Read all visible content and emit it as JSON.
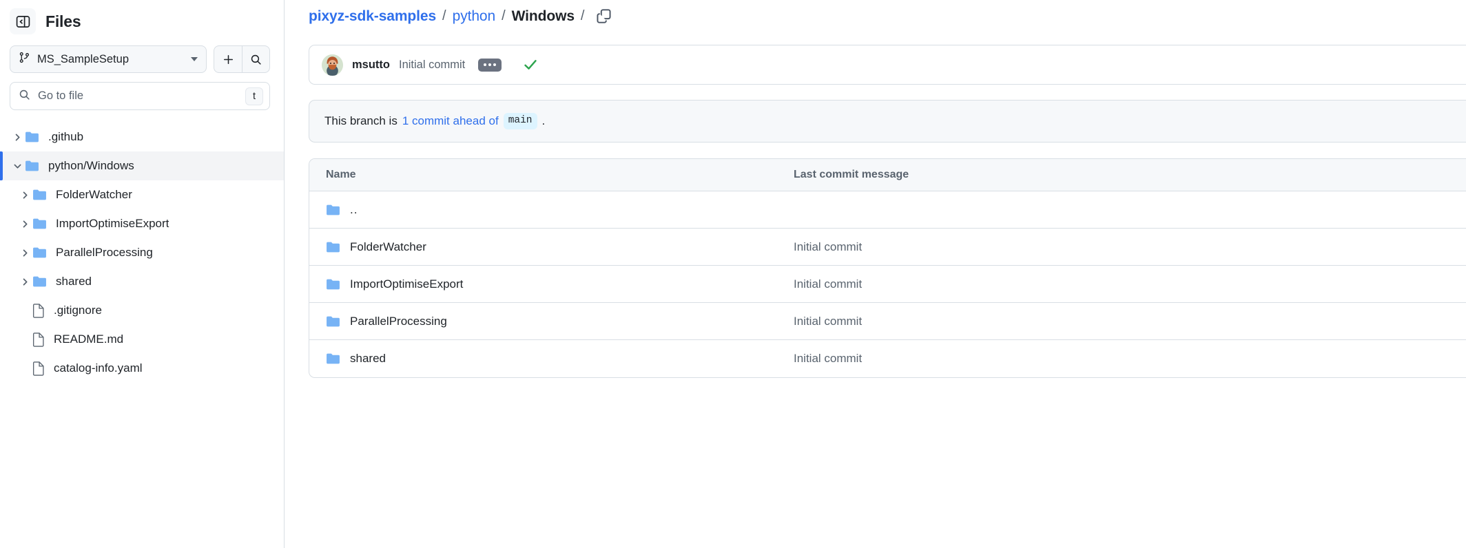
{
  "sidebar": {
    "title": "Files",
    "panel_toggle_icon": "collapse-panel-icon",
    "branch": {
      "name": "MS_SampleSetup",
      "icon": "git-branch-icon",
      "chevron_icon": "chevron-down-icon"
    },
    "add_button_icon": "plus-icon",
    "search_button_icon": "search-icon",
    "file_search": {
      "placeholder": "Go to file",
      "value": "",
      "icon": "search-icon",
      "shortcut": "t"
    },
    "tree": [
      {
        "label": ".github",
        "type": "folder",
        "depth": 0,
        "expanded": false,
        "selected": false
      },
      {
        "label": "python/Windows",
        "type": "folder-open",
        "depth": 0,
        "expanded": true,
        "selected": true
      },
      {
        "label": "FolderWatcher",
        "type": "folder",
        "depth": 1,
        "expanded": false,
        "selected": false
      },
      {
        "label": "ImportOptimiseExport",
        "type": "folder",
        "depth": 1,
        "expanded": false,
        "selected": false
      },
      {
        "label": "ParallelProcessing",
        "type": "folder",
        "depth": 1,
        "expanded": false,
        "selected": false
      },
      {
        "label": "shared",
        "type": "folder",
        "depth": 1,
        "expanded": false,
        "selected": false
      },
      {
        "label": ".gitignore",
        "type": "file",
        "depth": 1,
        "expanded": null,
        "selected": false
      },
      {
        "label": "README.md",
        "type": "file",
        "depth": 1,
        "expanded": null,
        "selected": false
      },
      {
        "label": "catalog-info.yaml",
        "type": "file",
        "depth": 1,
        "expanded": null,
        "selected": false
      }
    ]
  },
  "breadcrumb": {
    "repo": "pixyz-sdk-samples",
    "sep": "/",
    "path_part": "python",
    "current": "Windows",
    "trailing_sep": "/",
    "copy_icon": "copy-path-icon"
  },
  "commit": {
    "author": "msutto",
    "message": "Initial commit",
    "more_icon": "ellipsis-icon",
    "status_icon": "check-success-icon",
    "status_color": "#2da44e",
    "avatar_name": "avatar"
  },
  "notice": {
    "prefix": "This branch is",
    "link": "1 commit ahead of",
    "base_branch": "main",
    "suffix": "."
  },
  "table": {
    "columns": {
      "name": "Name",
      "last_commit": "Last commit message"
    },
    "rows": [
      {
        "name": "..",
        "type": "folder-up",
        "last_commit": ""
      },
      {
        "name": "FolderWatcher",
        "type": "folder",
        "last_commit": "Initial commit"
      },
      {
        "name": "ImportOptimiseExport",
        "type": "folder",
        "last_commit": "Initial commit"
      },
      {
        "name": "ParallelProcessing",
        "type": "folder",
        "last_commit": "Initial commit"
      },
      {
        "name": "shared",
        "type": "folder",
        "last_commit": "Initial commit"
      }
    ]
  },
  "colors": {
    "link_blue": "#2f6feb",
    "folder_blue": "#77b3f5",
    "success_green": "#2da44e",
    "panel_gray": "#f6f8fa",
    "border": "#d8dee4"
  }
}
